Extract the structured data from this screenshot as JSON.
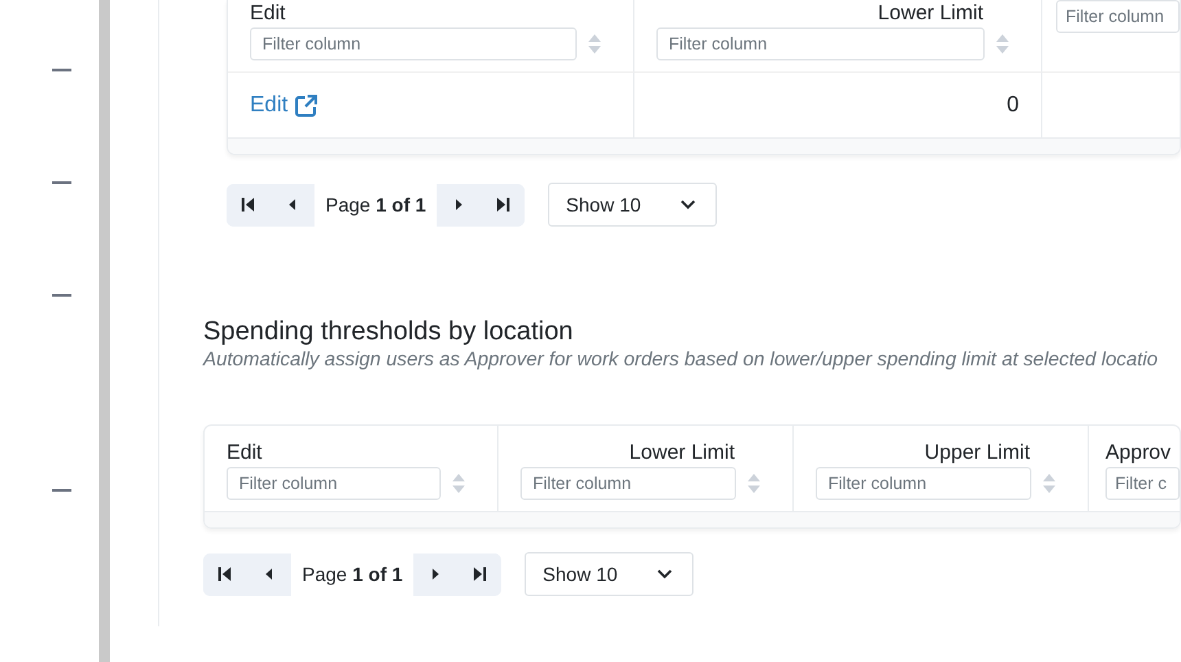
{
  "top_table": {
    "columns": [
      {
        "label": "Edit",
        "kind": "text",
        "placeholder": "Filter column"
      },
      {
        "label": "Lower Limit",
        "kind": "number",
        "placeholder": "Filter column"
      },
      {
        "placeholder": "Filter column"
      }
    ],
    "rows": [
      {
        "cells": [
          {
            "text": "Edit",
            "kind": "link"
          },
          {
            "text": "0",
            "kind": "number"
          }
        ]
      }
    ],
    "pagination": {
      "page": "Page **1 of 1**",
      "page_size": "Show 10"
    }
  },
  "section": {
    "title": "Spending thresholds by location",
    "subtitle": "Automatically assign users as Approver for work orders based on lower/upper spending limit at selected locatio"
  },
  "bottom_table": {
    "columns": [
      {
        "label": "Edit",
        "kind": "text",
        "placeholder": "Filter column"
      },
      {
        "label": "Lower Limit",
        "kind": "number",
        "placeholder": "Filter column"
      },
      {
        "label": "Upper Limit",
        "kind": "number",
        "placeholder": "Filter column"
      },
      {
        "label": "Approv",
        "kind": "text",
        "placeholder": "Filter c"
      }
    ],
    "pagination": {
      "page": "Page **1 of 1**",
      "page_size": "Show 10"
    }
  }
}
